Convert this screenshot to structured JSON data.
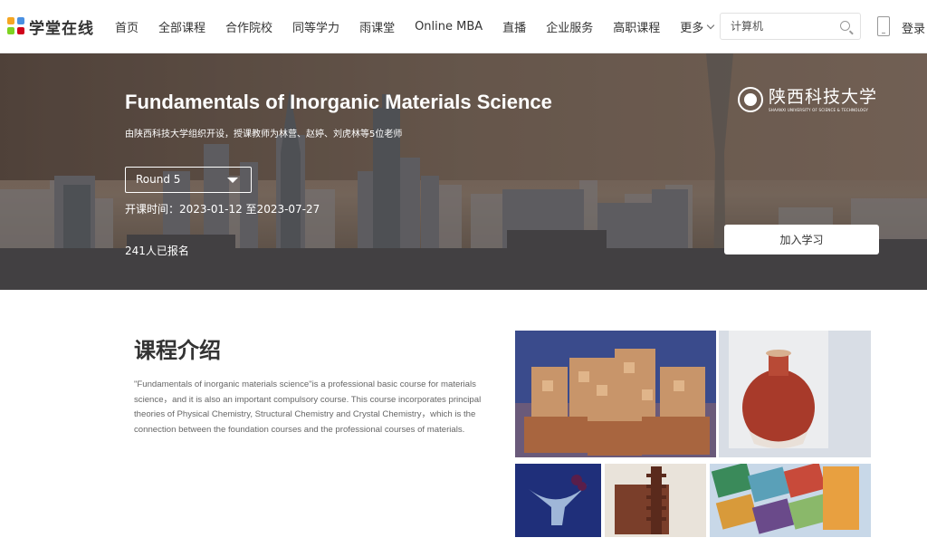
{
  "header": {
    "logo_text": "学堂在线",
    "nav": [
      {
        "label": "首页"
      },
      {
        "label": "全部课程"
      },
      {
        "label": "合作院校"
      },
      {
        "label": "同等学力"
      },
      {
        "label": "雨课堂"
      },
      {
        "label": "Online MBA"
      },
      {
        "label": "直播"
      },
      {
        "label": "企业服务"
      },
      {
        "label": "高职课程"
      }
    ],
    "more_label": "更多",
    "search_placeholder": "计算机",
    "login_label": "登录",
    "icons": {
      "search": "search-icon",
      "phone": "mobile-phone-icon",
      "more": "chevron-down-icon"
    }
  },
  "hero": {
    "title": "Fundamentals of Inorganic Materials Science",
    "subtitle": "由陕西科技大学组织开设，授课教师为林营、赵婷、刘虎林等5位老师",
    "round": "Round 5",
    "dates": "开课时间：2023-01-12 至2023-07-27",
    "enrolled": "241人已报名",
    "join_label": "加入学习",
    "university_name": "陕西科技大学",
    "university_en": "SHAANXI UNIVERSITY OF SCIENCE & TECHNOLOGY"
  },
  "intro": {
    "title": "课程介绍",
    "text": "\"Fundamentals of inorganic materials science\"is a professional basic course for materials science，and it is also an important compulsory course. This course incorporates principal theories of Physical Chemistry, Structural Chemistry and Crystal Chemistry，which is the connection between the foundation courses and the professional courses of materials."
  },
  "colors": {
    "nav_text": "#333333",
    "hero_text": "#ffffff",
    "body_text": "#666666"
  }
}
